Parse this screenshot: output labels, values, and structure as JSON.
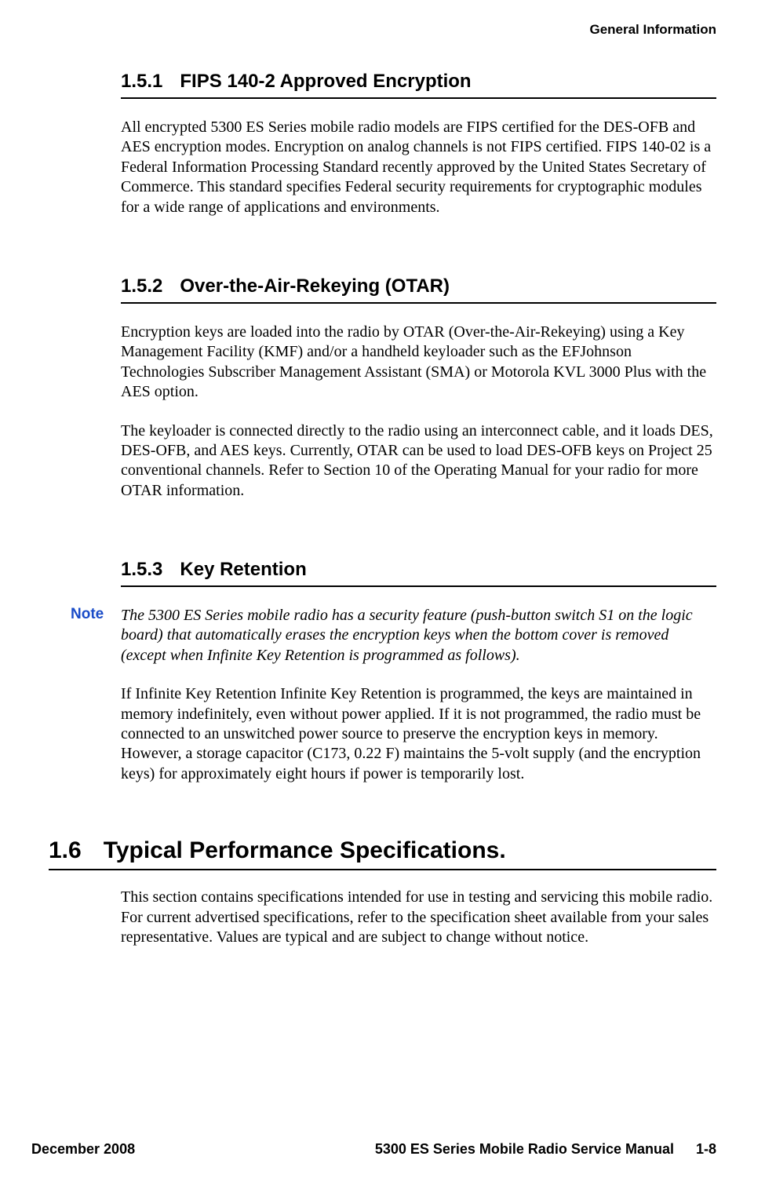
{
  "header": {
    "right": "General Information"
  },
  "sections": {
    "s151": {
      "number": "1.5.1",
      "title": "FIPS 140-2 Approved Encryption",
      "para1": "All encrypted 5300 ES Series mobile radio models are FIPS certified for the DES-OFB and AES encryption modes. Encryption on analog channels is not FIPS certified. FIPS 140-02 is a Federal Information Processing Standard recently approved by the United States Secretary of Commerce. This standard specifies Federal security requirements for cryptographic modules for a wide range of applications and environments."
    },
    "s152": {
      "number": "1.5.2",
      "title": "Over-the-Air-Rekeying (OTAR)",
      "para1": "Encryption keys are loaded into the radio by OTAR (Over-the-Air-Rekeying) using a Key Management Facility (KMF) and/or a handheld keyloader such as the EFJohnson Technologies Subscriber Management Assistant (SMA) or Motorola KVL 3000 Plus with the AES option.",
      "para2": "The keyloader is connected directly to the radio using an interconnect cable, and it loads DES, DES-OFB, and AES keys. Currently, OTAR can be used to load DES-OFB keys on Project 25 conventional channels. Refer to Section 10 of the Operating Manual for your radio for more OTAR information."
    },
    "s153": {
      "number": "1.5.3",
      "title": "Key Retention",
      "note_label": "Note",
      "note_text": "The 5300 ES Series mobile radio has a security feature (push-button switch S1 on the logic board) that automatically erases the encryption keys when the bottom cover is removed (except when Infinite Key Retention is programmed as follows).",
      "para1": "If Infinite Key Retention Infinite Key Retention is programmed, the keys are maintained in memory indefinitely, even without power applied. If it is not programmed, the radio must be connected to an unswitched power source to preserve the encryption keys in memory. However, a storage capacitor (C173, 0.22 F) maintains the 5-volt supply (and the encryption keys) for approximately eight hours if power is temporarily lost."
    },
    "s16": {
      "number": "1.6",
      "title": "Typical Performance Specifications.",
      "para1": "This section contains specifications intended for use in testing and servicing this mobile radio. For current advertised specifications, refer to the specification sheet available from your sales representative. Values are typical and are subject to change without notice."
    }
  },
  "footer": {
    "left": "December 2008",
    "center": "5300 ES Series Mobile Radio Service Manual",
    "page": "1-8"
  }
}
